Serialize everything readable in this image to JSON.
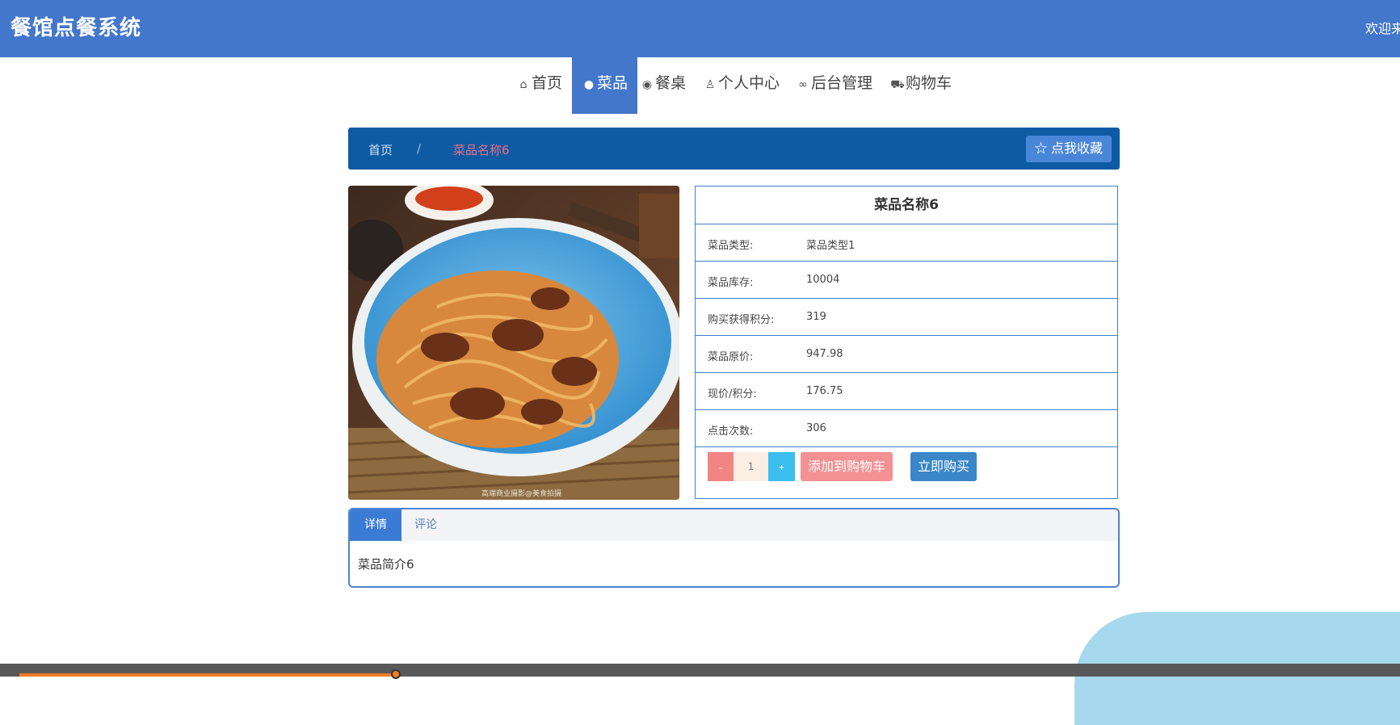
{
  "app": {
    "title": "餐馆点餐系统",
    "welcome": "欢迎来"
  },
  "nav": [
    {
      "icon": "home-icon",
      "glyph": "⌂",
      "label": "首页"
    },
    {
      "icon": "food-icon",
      "glyph": "●",
      "label": "菜品"
    },
    {
      "icon": "table-icon",
      "glyph": "◉",
      "label": "餐桌"
    },
    {
      "icon": "user-icon",
      "glyph": "♙",
      "label": "个人中心"
    },
    {
      "icon": "link-icon",
      "glyph": "∞",
      "label": "后台管理"
    },
    {
      "icon": "cart-icon",
      "glyph": "⛟",
      "label": "购物车"
    }
  ],
  "breadcrumb": {
    "home": "首页",
    "separator": "/",
    "current": "菜品名称6"
  },
  "favorite_button": "☆ 点我收藏",
  "product": {
    "name": "菜品名称6",
    "fields": [
      {
        "label": "菜品类型:",
        "value": "菜品类型1"
      },
      {
        "label": "菜品库存:",
        "value": "10004"
      },
      {
        "label": "购买获得积分:",
        "value": "319"
      },
      {
        "label": "菜品原价:",
        "value": "947.98"
      },
      {
        "label": "现价/积分:",
        "value": "176.75"
      },
      {
        "label": "点击次数:",
        "value": "306"
      }
    ],
    "quantity": "1",
    "minus": "-",
    "plus": "+",
    "add_to_cart": "添加到购物车",
    "buy_now": "立即购买",
    "photo_caption": "高端商业摄影@美食拍摄"
  },
  "tabs": {
    "details": "详情",
    "comments": "评论",
    "content": "菜品简介6"
  },
  "colors": {
    "primary": "#4377cb",
    "breadcrumb": "#0f5ba3",
    "border": "#3f7fc9"
  }
}
